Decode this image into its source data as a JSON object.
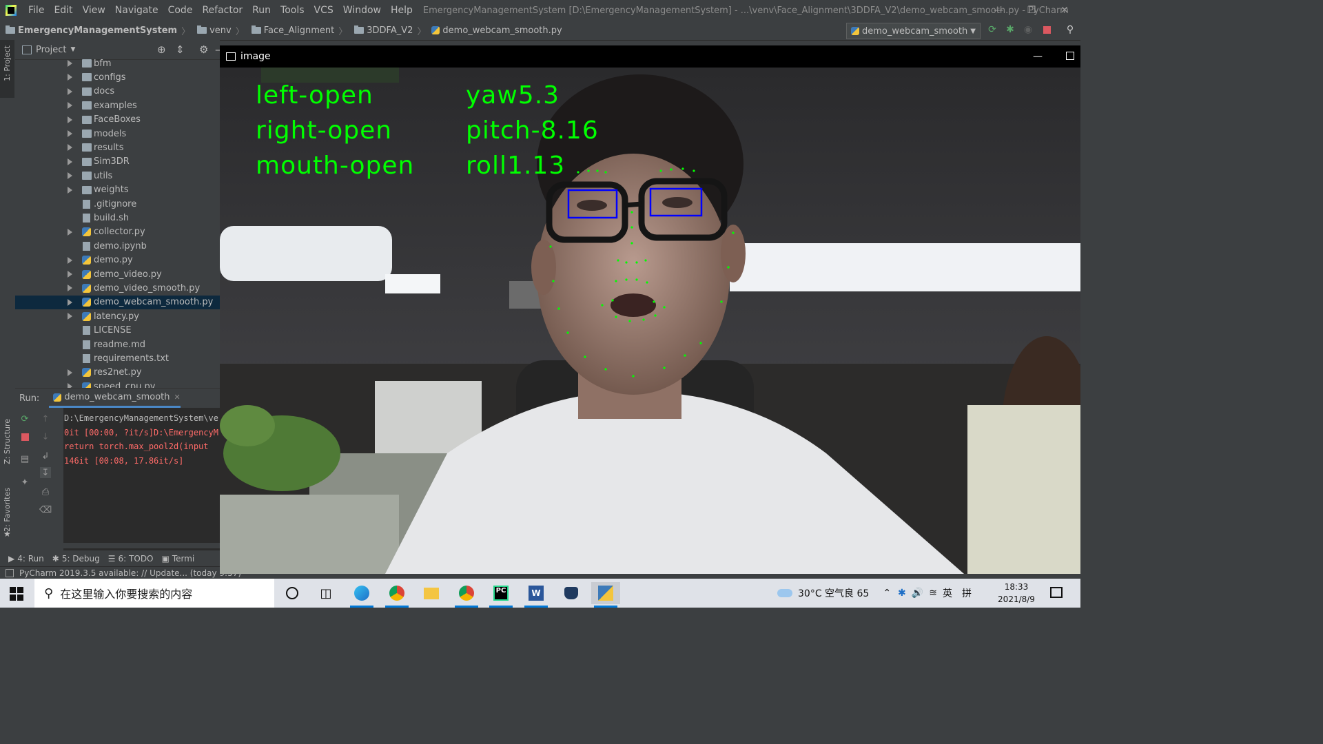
{
  "window": {
    "title": "EmergencyManagementSystem [D:\\EmergencyManagementSystem] - ...\\venv\\Face_Alignment\\3DDFA_V2\\demo_webcam_smooth.py - PyCharm"
  },
  "menu": [
    "File",
    "Edit",
    "View",
    "Navigate",
    "Code",
    "Refactor",
    "Run",
    "Tools",
    "VCS",
    "Window",
    "Help"
  ],
  "breadcrumb": [
    "EmergencyManagementSystem",
    "venv",
    "Face_Alignment",
    "3DDFA_V2",
    "demo_webcam_smooth.py"
  ],
  "toolbar": {
    "run_config": "demo_webcam_smooth"
  },
  "sidebar": {
    "project_tab": "1: Project",
    "structure_tab": "Z: Structure",
    "favorites_tab": "2: Favorites"
  },
  "project": {
    "header": "Project",
    "items": [
      {
        "name": "bfm",
        "kind": "folder",
        "expandable": true
      },
      {
        "name": "configs",
        "kind": "folder",
        "expandable": true
      },
      {
        "name": "docs",
        "kind": "folder",
        "expandable": true
      },
      {
        "name": "examples",
        "kind": "folder",
        "expandable": true
      },
      {
        "name": "FaceBoxes",
        "kind": "folder",
        "expandable": true
      },
      {
        "name": "models",
        "kind": "folder",
        "expandable": true
      },
      {
        "name": "results",
        "kind": "folder",
        "expandable": true
      },
      {
        "name": "Sim3DR",
        "kind": "folder",
        "expandable": true
      },
      {
        "name": "utils",
        "kind": "folder",
        "expandable": true
      },
      {
        "name": "weights",
        "kind": "folder",
        "expandable": true
      },
      {
        "name": ".gitignore",
        "kind": "file",
        "expandable": false
      },
      {
        "name": "build.sh",
        "kind": "file",
        "expandable": false
      },
      {
        "name": "collector.py",
        "kind": "py",
        "expandable": true
      },
      {
        "name": "demo.ipynb",
        "kind": "file",
        "expandable": false
      },
      {
        "name": "demo.py",
        "kind": "py",
        "expandable": true
      },
      {
        "name": "demo_video.py",
        "kind": "py",
        "expandable": true
      },
      {
        "name": "demo_video_smooth.py",
        "kind": "py",
        "expandable": true
      },
      {
        "name": "demo_webcam_smooth.py",
        "kind": "py",
        "expandable": true,
        "selected": true
      },
      {
        "name": "latency.py",
        "kind": "py",
        "expandable": true
      },
      {
        "name": "LICENSE",
        "kind": "file",
        "expandable": false
      },
      {
        "name": "readme.md",
        "kind": "file",
        "expandable": false
      },
      {
        "name": "requirements.txt",
        "kind": "file",
        "expandable": false
      },
      {
        "name": "res2net.py",
        "kind": "py",
        "expandable": true
      },
      {
        "name": "speed_cpu.py",
        "kind": "py",
        "expandable": true
      }
    ]
  },
  "run": {
    "label": "Run:",
    "tab": "demo_webcam_smooth",
    "console": [
      {
        "text": "D:\\EmergencyManagementSystem\\ve",
        "color": "#bbbbbb"
      },
      {
        "text": "0it [00:00, ?it/s]D:\\EmergencyM",
        "color": "#ff6b68"
      },
      {
        "text": "  return torch.max_pool2d(input",
        "color": "#ff6b68"
      },
      {
        "text": "146it [00:08, 17.86it/s]",
        "color": "#ff6b68"
      }
    ]
  },
  "bottom_tabs": [
    "4: Run",
    "5: Debug",
    "6: TODO",
    "Termi"
  ],
  "status": {
    "message": "PyCharm 2019.3.5 available: // Update... (today 9:57)"
  },
  "image_window": {
    "title": "image",
    "overlay": {
      "left_eye": "left-open",
      "right_eye": "right-open",
      "mouth": "mouth-open",
      "yaw": "yaw5.3",
      "pitch": "pitch-8.16",
      "roll": "roll1.13"
    }
  },
  "taskbar": {
    "search_placeholder": "在这里输入你要搜索的内容",
    "weather": "30°C 空气良 65",
    "ime1": "英",
    "ime2": "拼",
    "time": "18:33",
    "date": "2021/8/9"
  },
  "colors": {
    "ide_bg": "#3c3f41",
    "editor_bg": "#2b2b2b",
    "overlay_text": "#00ff00",
    "eye_box": "#0000ff",
    "selection": "#0d293e"
  }
}
